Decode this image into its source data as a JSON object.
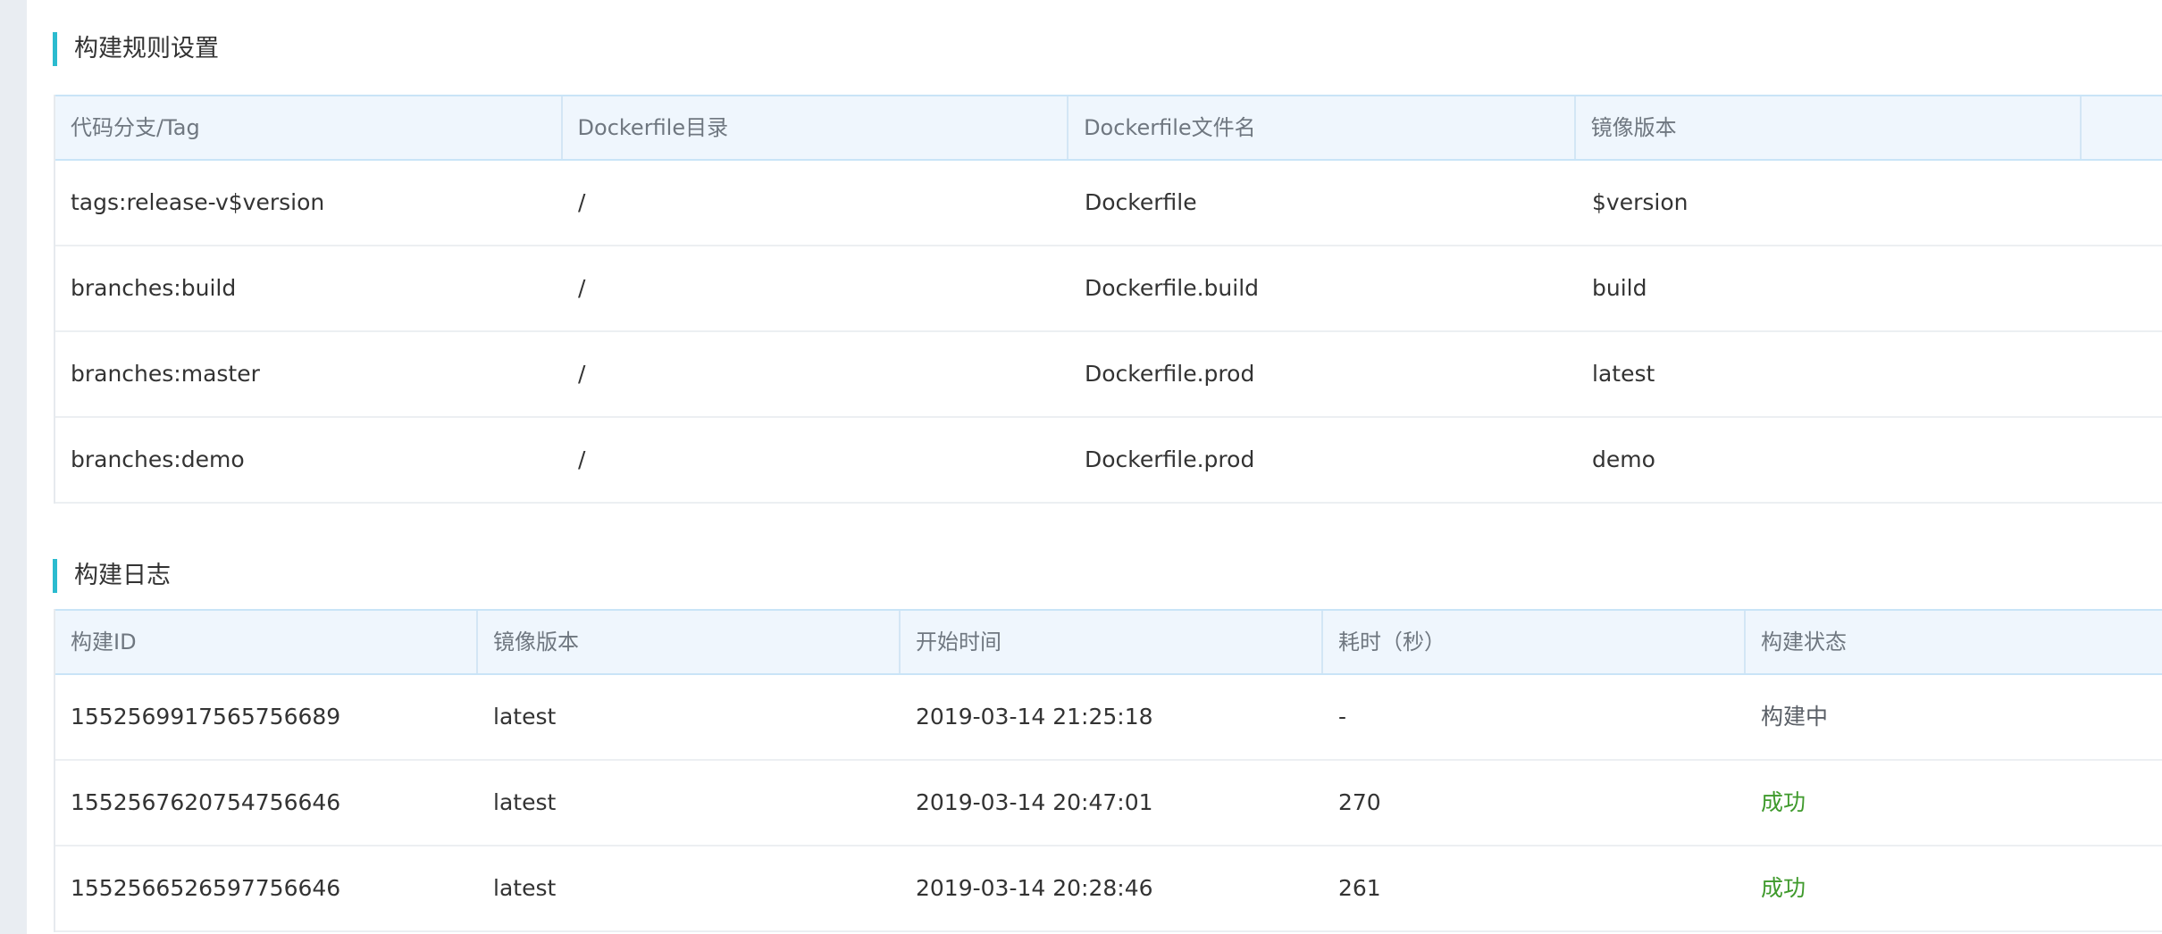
{
  "rules_section": {
    "title": "构建规则设置",
    "columns": [
      "代码分支/Tag",
      "Dockerfile目录",
      "Dockerfile文件名",
      "镜像版本"
    ],
    "rows": [
      {
        "branch": "tags:release-v$version",
        "dir": "/",
        "file": "Dockerfile",
        "version": "$version"
      },
      {
        "branch": "branches:build",
        "dir": "/",
        "file": "Dockerfile.build",
        "version": "build"
      },
      {
        "branch": "branches:master",
        "dir": "/",
        "file": "Dockerfile.prod",
        "version": "latest"
      },
      {
        "branch": "branches:demo",
        "dir": "/",
        "file": "Dockerfile.prod",
        "version": "demo"
      }
    ]
  },
  "log_section": {
    "title": "构建日志",
    "columns": [
      "构建ID",
      "镜像版本",
      "开始时间",
      "耗时（秒）",
      "构建状态"
    ],
    "rows": [
      {
        "id": "1552569917565756689",
        "version": "latest",
        "start": "2019-03-14 21:25:18",
        "duration": "-",
        "status": "构建中",
        "status_kind": "running"
      },
      {
        "id": "1552567620754756646",
        "version": "latest",
        "start": "2019-03-14 20:47:01",
        "duration": "270",
        "status": "成功",
        "status_kind": "success"
      },
      {
        "id": "1552566526597756646",
        "version": "latest",
        "start": "2019-03-14 20:28:46",
        "duration": "261",
        "status": "成功",
        "status_kind": "success"
      }
    ]
  },
  "colors": {
    "accent": "#2bbbcf",
    "header_bg": "#eff6fd",
    "success": "#3f9a2c",
    "running": "#5a5f66"
  }
}
